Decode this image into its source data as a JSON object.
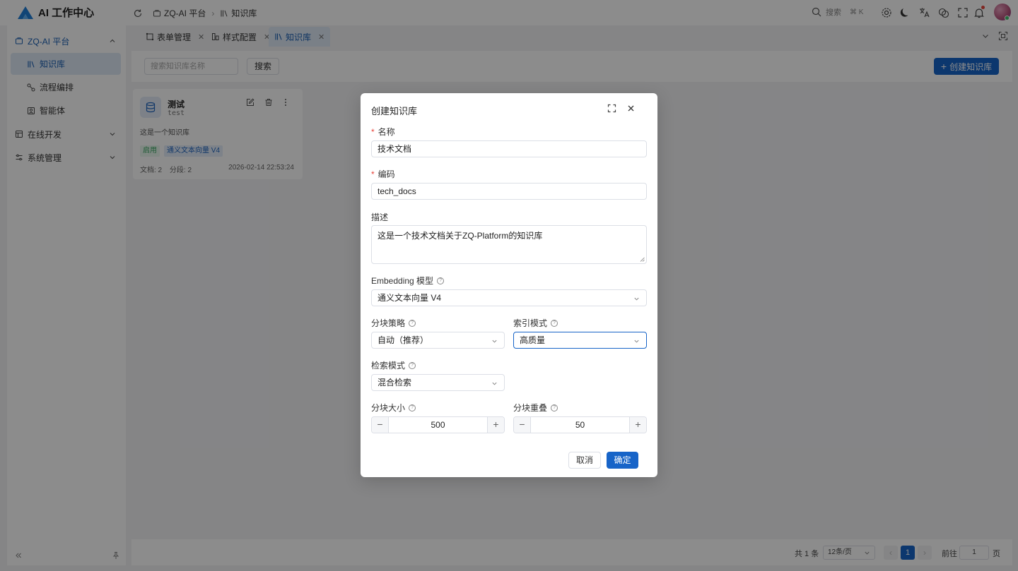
{
  "app": {
    "title": "AI 工作中心",
    "breadcrumb": [
      "ZQ-AI 平台",
      "知识库"
    ],
    "search_label": "搜索",
    "search_shortcut": "⌘ K",
    "brand_color": "#1764c8"
  },
  "sidebar": {
    "groups": [
      {
        "label": "ZQ-AI 平台",
        "expanded": true,
        "items": [
          {
            "label": "知识库",
            "active": true
          },
          {
            "label": "流程编排"
          },
          {
            "label": "智能体"
          }
        ]
      },
      {
        "label": "在线开发",
        "expanded": false
      },
      {
        "label": "系统管理",
        "expanded": false
      }
    ]
  },
  "tabs": [
    {
      "label": "表单管理"
    },
    {
      "label": "样式配置"
    },
    {
      "label": "知识库",
      "active": true
    }
  ],
  "toolbar": {
    "search_placeholder": "搜索知识库名称",
    "search_button": "搜索",
    "create_button": "创建知识库"
  },
  "knowledge_bases": [
    {
      "name": "测试",
      "code": "test",
      "description": "这是一个知识库",
      "status": "启用",
      "model": "通义文本向量 V4",
      "docs": "文档: 2",
      "segments": "分段: 2",
      "updated": "2026-02-14 22:53:24"
    }
  ],
  "pagination": {
    "total": "共 1 条",
    "page_size": "12条/页",
    "current_page": "1",
    "goto_label": "前往",
    "goto_value": "1",
    "page_suffix": "页"
  },
  "dialog": {
    "title": "创建知识库",
    "name_label": "名称",
    "name_value": "技术文档",
    "code_label": "编码",
    "code_value": "tech_docs",
    "desc_label": "描述",
    "desc_value": "这是一个技术文档关于ZQ-Platform的知识库",
    "embedding_label": "Embedding 模型",
    "embedding_value": "通义文本向量 V4",
    "chunk_strategy_label": "分块策略",
    "chunk_strategy_value": "自动（推荐）",
    "index_mode_label": "索引模式",
    "index_mode_value": "高质量",
    "retrieval_mode_label": "检索模式",
    "retrieval_mode_value": "混合检索",
    "chunk_size_label": "分块大小",
    "chunk_size_value": "500",
    "chunk_overlap_label": "分块重叠",
    "chunk_overlap_value": "50",
    "cancel_button": "取消",
    "confirm_button": "确定"
  }
}
